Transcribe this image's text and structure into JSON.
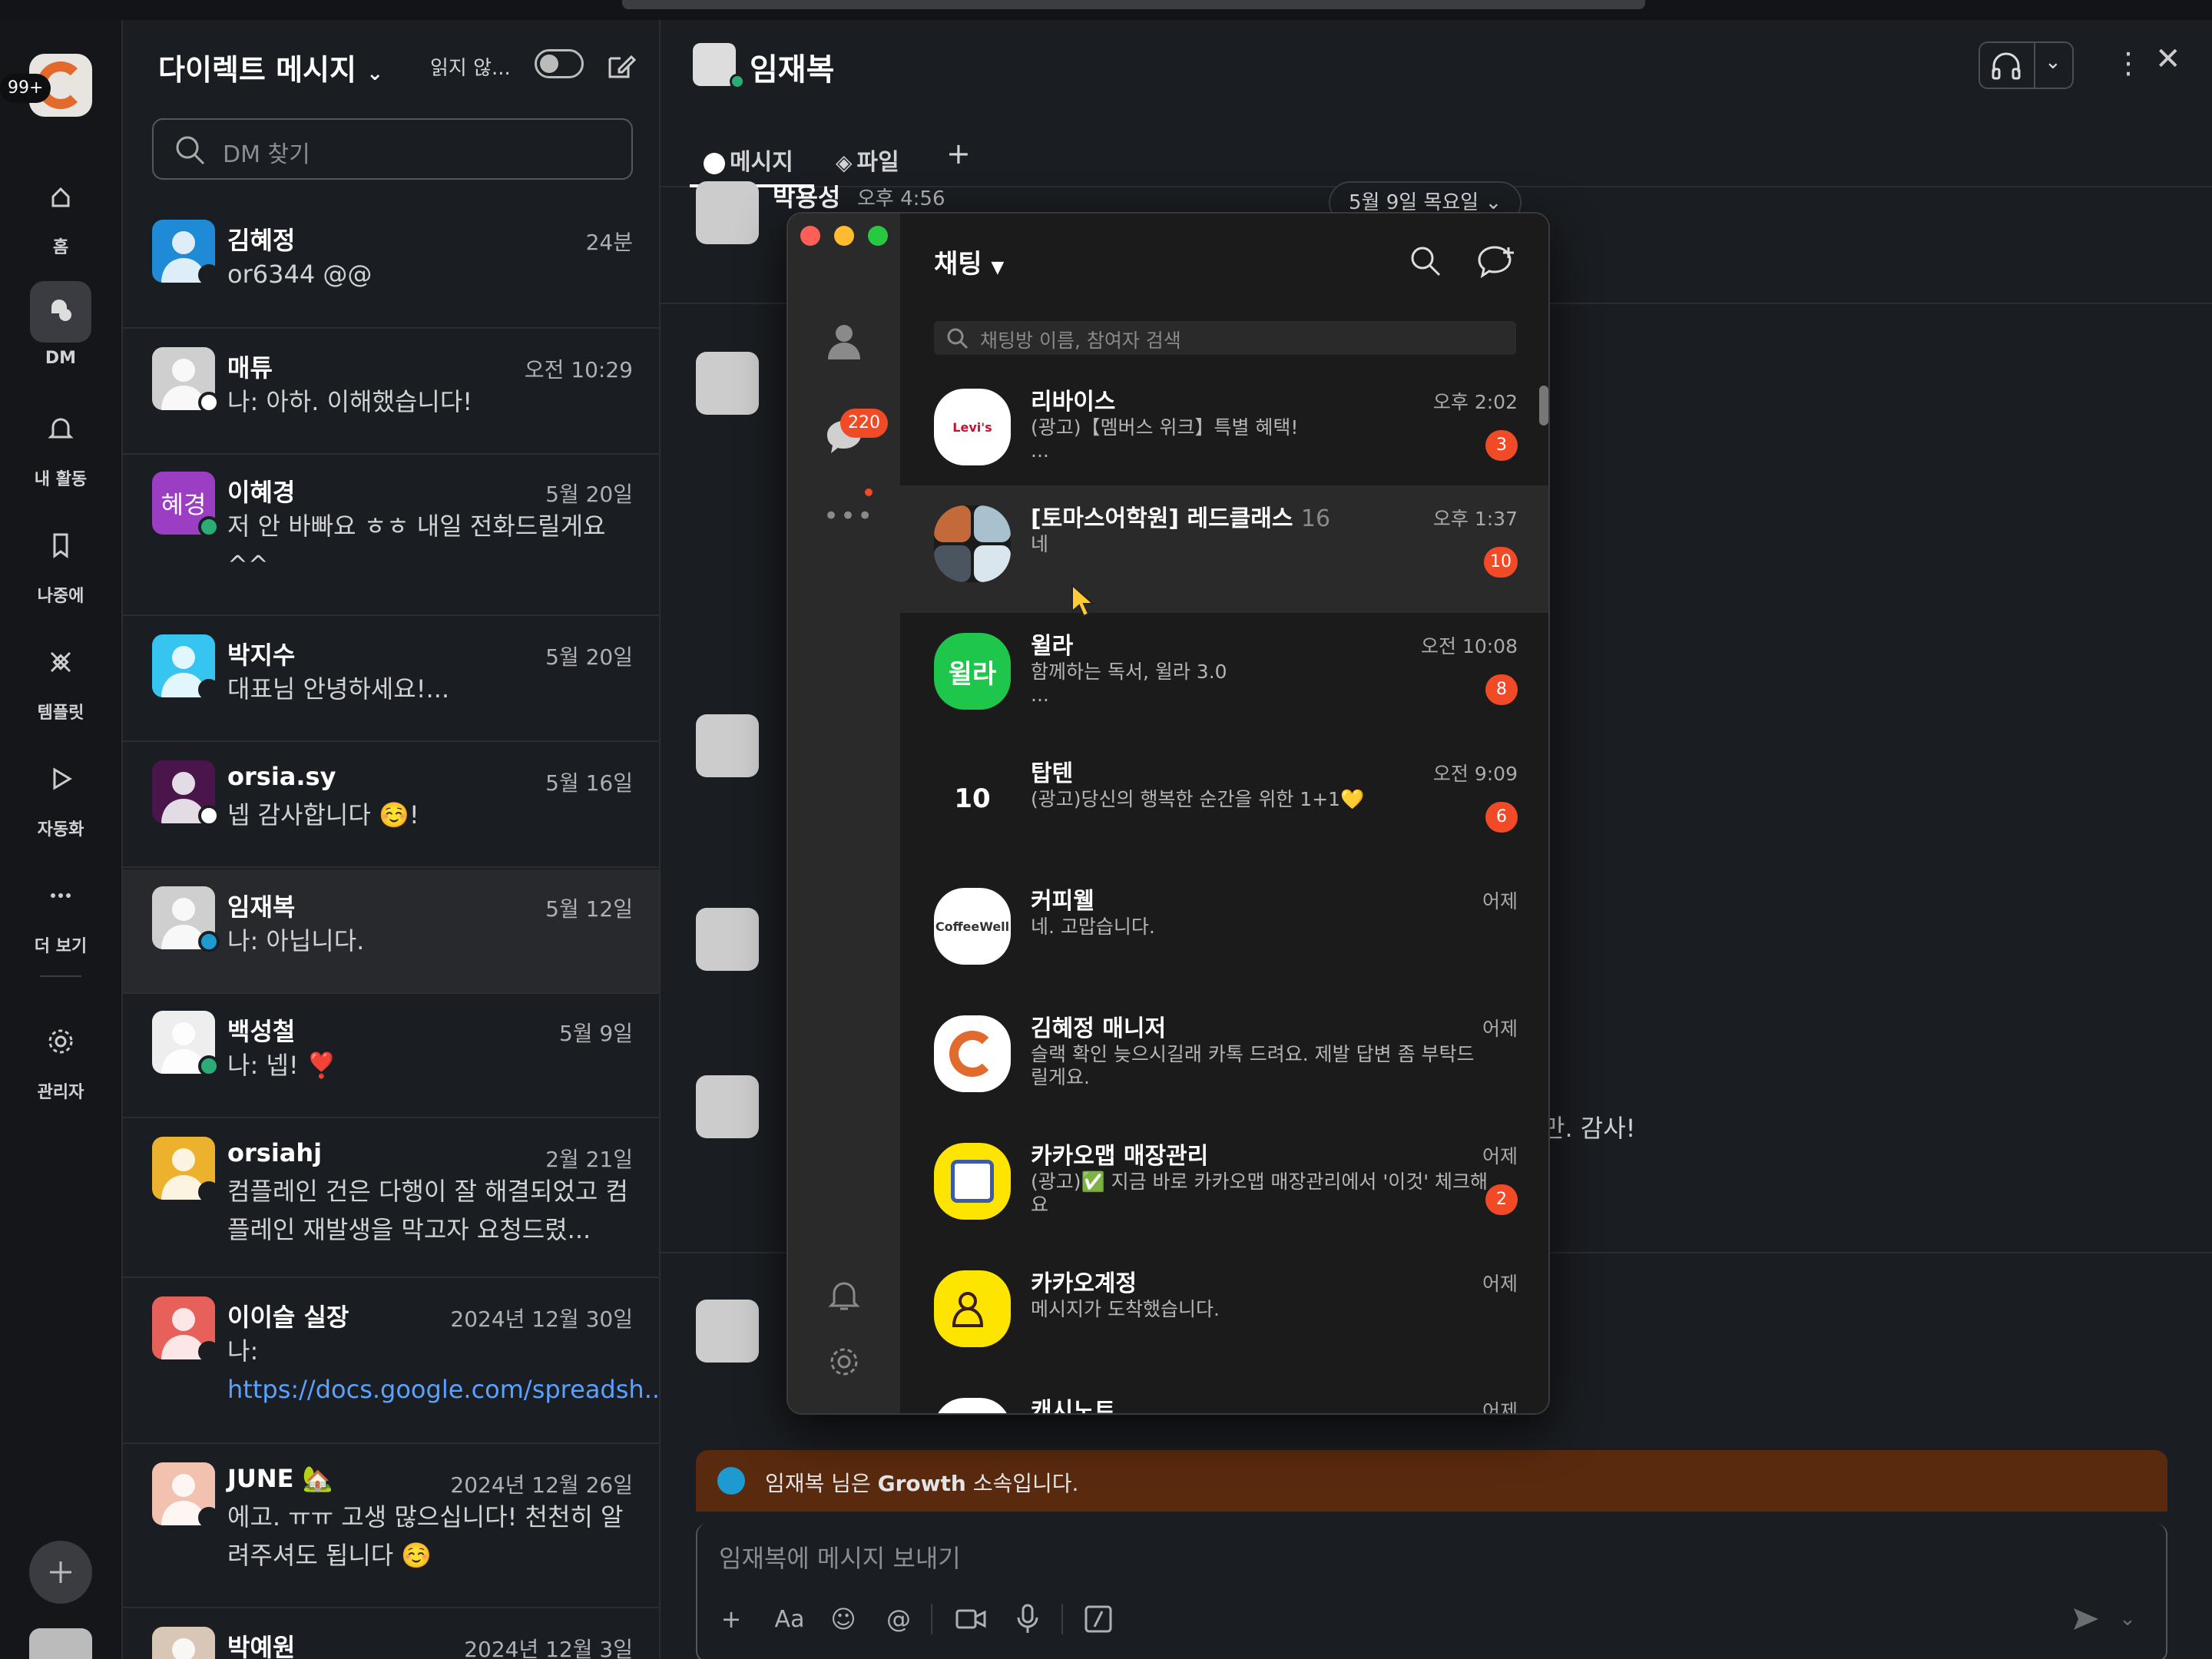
{
  "workspace_badge": "99+",
  "rail": [
    {
      "label": "홈",
      "icon": "home-icon"
    },
    {
      "label": "DM",
      "icon": "dm-icon"
    },
    {
      "label": "내 활동",
      "icon": "bell-icon"
    },
    {
      "label": "나중에",
      "icon": "bookmark-icon"
    },
    {
      "label": "템플릿",
      "icon": "template-icon"
    },
    {
      "label": "자동화",
      "icon": "play-icon"
    },
    {
      "label": "더 보기",
      "icon": "more-icon"
    },
    {
      "label": "관리자",
      "icon": "gear-icon"
    }
  ],
  "dm": {
    "title": "다이렉트 메시지",
    "unread_label": "읽지 않...",
    "search_placeholder": "DM 찾기",
    "rows": [
      {
        "name": "김혜정",
        "time": "24분",
        "preview": "or6344 @@",
        "avatar_color": "#1f8ad6",
        "status": "#1a1d21"
      },
      {
        "name": "매튜",
        "time": "오전 10:29",
        "preview": "나: 아하. 이해했습니다!",
        "avatar_color": "#cfcfcf",
        "status": "#ffffff"
      },
      {
        "name": "이혜경",
        "time": "5월 20일",
        "preview": "저 안 바빠요 ㅎㅎ 내일 전화드릴게요 ^^",
        "avatar_color": "#9b3ec4",
        "avatar_text": "혜경",
        "status": "#2bac76"
      },
      {
        "name": "박지수",
        "time": "5월 20일",
        "preview": "대표님 안녕하세요!...",
        "avatar_color": "#36c5f0",
        "status": "#1a1d21"
      },
      {
        "name": "orsia.sy",
        "time": "5월 16일",
        "preview": "넵 감사합니다 ☺️!",
        "avatar_color": "#4a154b",
        "status": "#ffffff"
      },
      {
        "name": "임재복",
        "time": "5월 12일",
        "preview": "나: 아닙니다.",
        "avatar_color": "#cfcfcf",
        "status": "#1d9bd1"
      },
      {
        "name": "백성철",
        "time": "5월 9일",
        "preview": "나: 넵! ❣️",
        "avatar_color": "#eeeeee",
        "status": "#2bac76"
      },
      {
        "name": "orsiahj",
        "time": "2월 21일",
        "preview": "컴플레인 건은 다행이 잘 해결되었고 컴플레인 재발생을 막고자 요청드렸...",
        "avatar_color": "#ecb22e",
        "status": "#1a1d21"
      },
      {
        "name": "이이슬 실장",
        "time": "2024년 12월 30일",
        "preview": "나:",
        "link": "https://docs.google.com/spreadsh...",
        "avatar_color": "#e8605a",
        "status": "#1a1d21"
      },
      {
        "name": "JUNE 🏡",
        "time": "2024년 12월 26일",
        "preview": "에고. ㅠㅠ 고생 많으십니다! 천천히 알려주셔도 됩니다 ☺️",
        "avatar_color": "#f2c1b0",
        "status": "#1a1d21"
      },
      {
        "name": "박예원",
        "time": "2024년 12월 3일",
        "preview": "",
        "avatar_color": "#d8c7b7",
        "status": "#1a1d21"
      }
    ]
  },
  "chat": {
    "title": "임재복",
    "tabs": [
      {
        "label": "메시지"
      },
      {
        "label": "파일"
      }
    ],
    "first_sender": "박용성",
    "first_time": "오후 4:56",
    "date_pill": "5월 9일 목요일",
    "partial_text": "만. 감사!",
    "notice_name": "임재복",
    "notice_mid": " 님은 ",
    "notice_org": "Growth",
    "notice_tail": " 소속입니다.",
    "composer_placeholder": "임재복에 메시지 보내기"
  },
  "kakao": {
    "title": "채팅",
    "search_placeholder": "채팅방 이름, 참여자 검색",
    "side_badge": "220",
    "rows": [
      {
        "name": "리바이스",
        "count": "",
        "msg": "(광고)【멤버스 위크】특별 혜택!\n...",
        "time": "오후 2:02",
        "badge": "3",
        "avatar_bg": "#ffffff",
        "avatar_text": "Levi's",
        "avatar_fg": "#c41230"
      },
      {
        "name": "[토마스어학원] 레드클래스",
        "count": "16",
        "msg": "네",
        "time": "오후 1:37",
        "badge": "10",
        "avatar_bg": "#5a6470",
        "avatar_text": "",
        "avatar_fg": "#ffffff"
      },
      {
        "name": "윌라",
        "count": "",
        "msg": "함께하는 독서, 윌라 3.0\n...",
        "time": "오전 10:08",
        "badge": "8",
        "avatar_bg": "#1ec64b",
        "avatar_text": "윌라",
        "avatar_fg": "#ffffff"
      },
      {
        "name": "탑텐",
        "count": "",
        "msg": "(광고)당신의 행복한 순간을 위한 1+1💛",
        "time": "오전 9:09",
        "badge": "6",
        "avatar_bg": "#1b1b1b",
        "avatar_text": "10",
        "avatar_fg": "#ffffff"
      },
      {
        "name": "커피웰",
        "count": "",
        "msg": "네. 고맙습니다.",
        "time": "어제",
        "badge": "",
        "avatar_bg": "#ffffff",
        "avatar_text": "CoffeeWell",
        "avatar_fg": "#333333"
      },
      {
        "name": "김혜정 매니저",
        "count": "",
        "msg": "슬랙 확인 늦으시길래 카톡 드려요. 제발 답변 좀 부탁드릴게요.",
        "time": "어제",
        "badge": "",
        "avatar_bg": "#ffffff",
        "avatar_text": "",
        "avatar_fg": "#e26a2c"
      },
      {
        "name": "카카오맵 매장관리",
        "count": "",
        "msg": "(광고)✅ 지금 바로 카카오맵 매장관리에서 '이것' 체크해요",
        "time": "어제",
        "badge": "2",
        "avatar_bg": "#fee500",
        "avatar_text": "",
        "avatar_fg": "#3c5ba8"
      },
      {
        "name": "카카오계정",
        "count": "",
        "msg": "메시지가 도착했습니다.",
        "time": "어제",
        "badge": "",
        "avatar_bg": "#fee500",
        "avatar_text": "",
        "avatar_fg": "#3c1e1e"
      },
      {
        "name": "캐시노트",
        "count": "",
        "msg": "",
        "time": "어제",
        "badge": "",
        "avatar_bg": "#ffffff",
        "avatar_text": "",
        "avatar_fg": "#333333"
      }
    ]
  }
}
